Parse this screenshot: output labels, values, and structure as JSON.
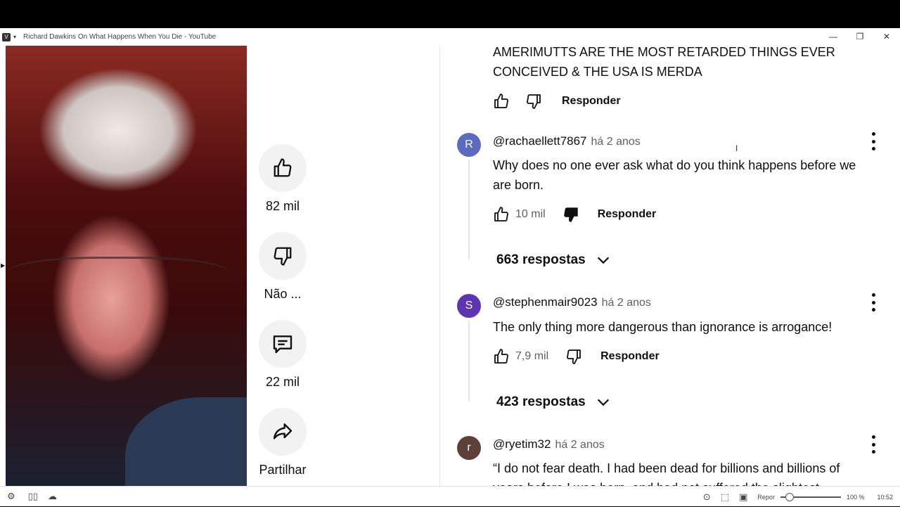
{
  "window": {
    "title": "Richard Dawkins On What Happens When You Die - YouTube",
    "minimize": "—",
    "restore": "❐",
    "close": "✕"
  },
  "actions": {
    "like_count": "82 mil",
    "dislike_label": "Não ...",
    "comments_count": "22 mil",
    "share_label": "Partilhar"
  },
  "comments": [
    {
      "text_line1": "AMERIMUTTS ARE THE MOST RETARDED THINGS EVER",
      "text_line2": "CONCEIVED & THE USA IS MERDA",
      "reply_label": "Responder"
    },
    {
      "avatar_letter": "R",
      "avatar_color": "#5c6bc0",
      "author": "@rachaellett7867",
      "time": "há 2 anos",
      "text_line1": "Why does no one ever ask what do you think happens before we",
      "text_line2": "are born.",
      "likes": "10 mil",
      "reply_label": "Responder",
      "replies": "663 respostas"
    },
    {
      "avatar_letter": "S",
      "avatar_color": "#5e35b1",
      "author": "@stephenmair9023",
      "time": "há 2 anos",
      "text_line1": "The only thing more dangerous than ignorance is arrogance!",
      "likes": "7,9 mil",
      "reply_label": "Responder",
      "replies": "423 respostas"
    },
    {
      "avatar_letter": "r",
      "avatar_color": "#5d4037",
      "author": "@ryetim32",
      "time": "há 2 anos",
      "text_line1": "“I do not fear death. I had been dead for billions and billions of",
      "text_line2": "years before I was born, and had not suffered the slightest"
    }
  ],
  "taskbar": {
    "repeat_label": "Repor",
    "zoom": "100 %",
    "clock": "10:52",
    "zoom_level": 0.15
  }
}
